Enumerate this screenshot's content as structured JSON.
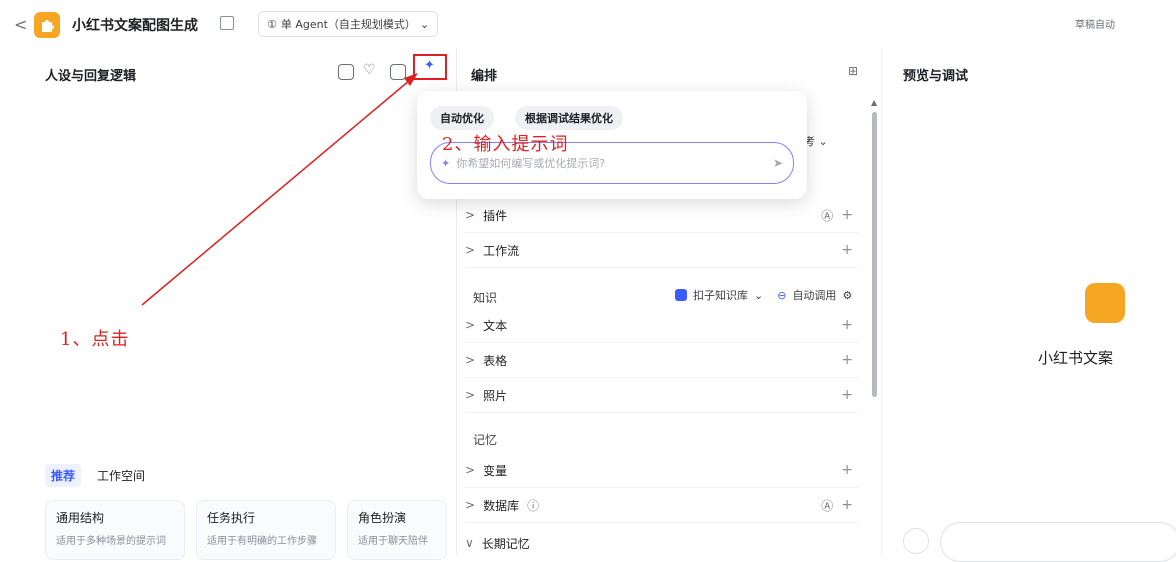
{
  "header": {
    "back_glyph": "<",
    "app_title": "小红书文案配图生成",
    "mode_label": "单 Agent（自主规划模式）",
    "draft_status": "草稿自动"
  },
  "left_panel": {
    "title": "人设与回复逻辑",
    "tabs": [
      "推荐",
      "工作空间"
    ],
    "cards": [
      {
        "title": "通用结构",
        "desc": "适用于多种场景的提示词"
      },
      {
        "title": "任务执行",
        "desc": "适用于有明确的工作步骤"
      },
      {
        "title": "角色扮演",
        "desc": "适用于聊天陪伴"
      }
    ]
  },
  "middle_panel": {
    "title": "编排",
    "model_hint": "思考",
    "rows_skills": [
      {
        "label": "插件",
        "auto": true
      },
      {
        "label": "工作流",
        "auto": false
      }
    ],
    "knowledge": {
      "title": "知识",
      "kb_label": "扣子知识库",
      "auto_call": "自动调用",
      "rows": [
        "文本",
        "表格",
        "照片"
      ]
    },
    "memory": {
      "title": "记忆",
      "rows": [
        {
          "label": "变量",
          "auto": false,
          "info": false
        },
        {
          "label": "数据库",
          "auto": true,
          "info": true
        },
        {
          "label": "长期记忆",
          "auto": false,
          "info": false
        }
      ]
    }
  },
  "popup": {
    "pills": [
      "自动优化",
      "根据调试结果优化"
    ],
    "placeholder": "你希望如何编写或优化提示词?"
  },
  "right_panel": {
    "title": "预览与调试",
    "app_name": "小红书文案"
  },
  "annotations": {
    "step1": "1、点击",
    "step2": "2、输入提示词"
  },
  "colors": {
    "accent": "#3b5bfd",
    "annotation_red": "#e02020",
    "app_icon": "#f5a623"
  }
}
